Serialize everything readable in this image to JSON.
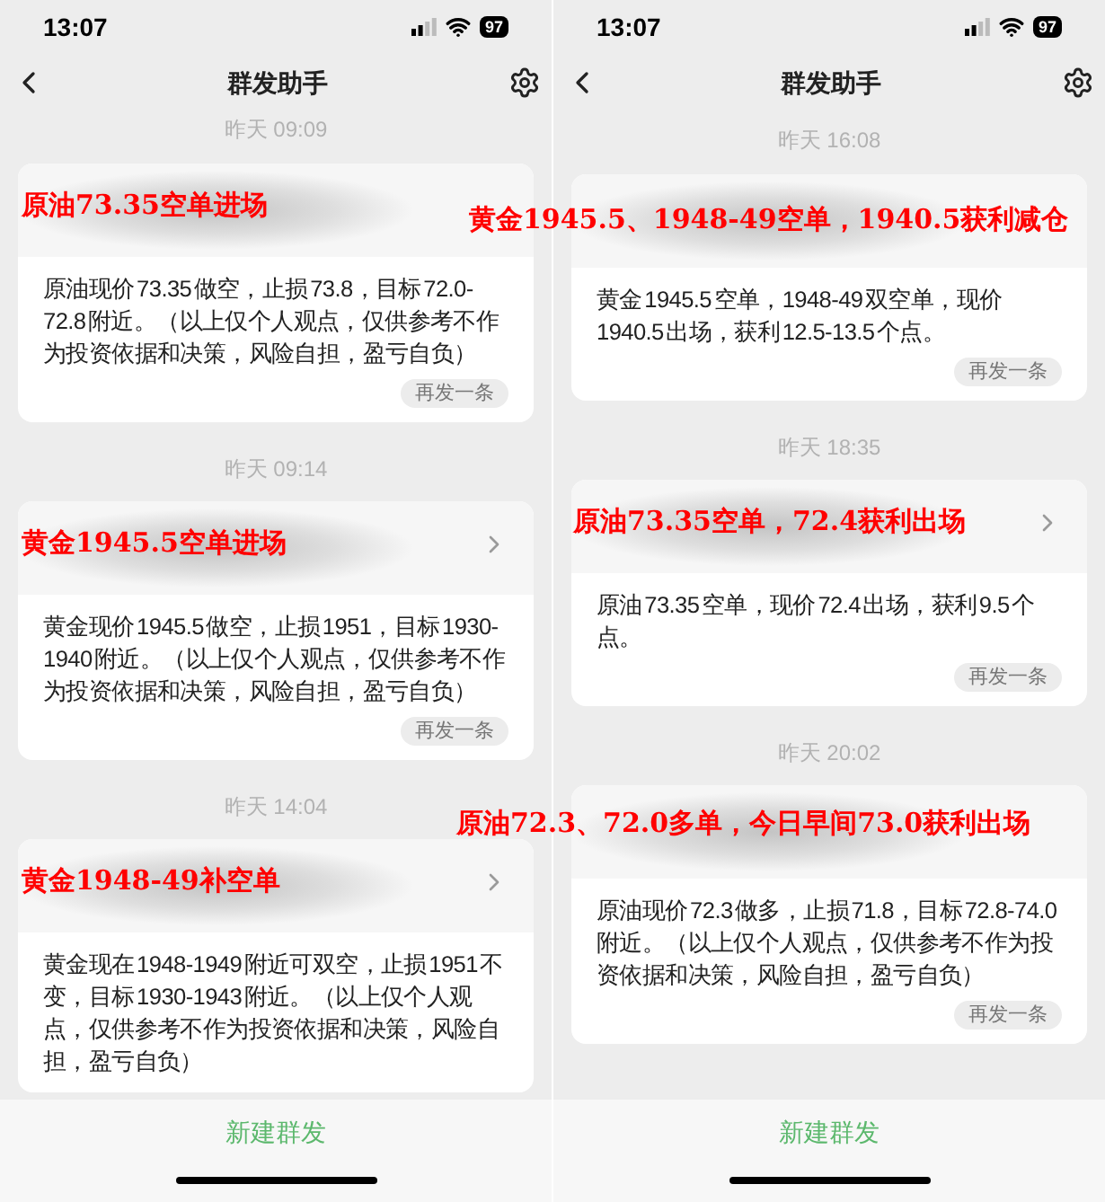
{
  "phones": [
    {
      "status_bar": {
        "time": "13:07",
        "battery": "97"
      },
      "nav": {
        "title": "群发助手"
      },
      "messages": [
        {
          "time": "昨天 09:09",
          "annotation": "原油73.35空单进场",
          "chevron": false,
          "body": "原油现价 73.35 做空，止损 73.8，目标 72.0-72.8 附近。（以上仅个人观点，仅供参考不作为投资依据和决策，风险自担，盈亏自负）",
          "resend": "再发一条"
        },
        {
          "time": "昨天 09:14",
          "annotation": "黄金1945.5空单进场",
          "chevron": true,
          "body": "黄金现价 1945.5 做空，止损 1951，目标 1930-1940 附近。（以上仅个人观点，仅供参考不作为投资依据和决策，风险自担，盈亏自负）",
          "resend": "再发一条"
        },
        {
          "time": "昨天 14:04",
          "annotation": "黄金1948-49补空单",
          "chevron": true,
          "body": "黄金现在 1948-1949 附近可双空，止损 1951 不变，目标 1930-1943 附近。（以上仅个人观点，仅供参考不作为投资依据和决策，风险自担，盈亏自负）"
        }
      ],
      "bottom_button": "新建群发"
    },
    {
      "status_bar": {
        "time": "13:07",
        "battery": "97"
      },
      "nav": {
        "title": "群发助手"
      },
      "messages": [
        {
          "time": "昨天 16:08",
          "annotation": "黄金1945.5、1948-49空单，1940.5获利减仓",
          "chevron": false,
          "body": "黄金 1945.5 空单，1948-49 双空单，现价 1940.5 出场，获利 12.5-13.5 个点。",
          "resend": "再发一条"
        },
        {
          "time": "昨天 18:35",
          "annotation": "原油73.35空单，72.4获利出场",
          "chevron": true,
          "body": "原油 73.35 空单，现价 72.4 出场，获利 9.5 个点。",
          "resend": "再发一条"
        },
        {
          "time": "昨天 20:02",
          "annotation": "原油72.3、72.0多单，今日早间73.0获利出场",
          "chevron": false,
          "body": "原油现价 72.3 做多，止损 71.8，目标 72.8-74.0 附近。（以上仅个人观点，仅供参考不作为投资依据和决策，风险自担，盈亏自负）",
          "resend": "再发一条"
        }
      ],
      "bottom_button": "新建群发"
    }
  ]
}
